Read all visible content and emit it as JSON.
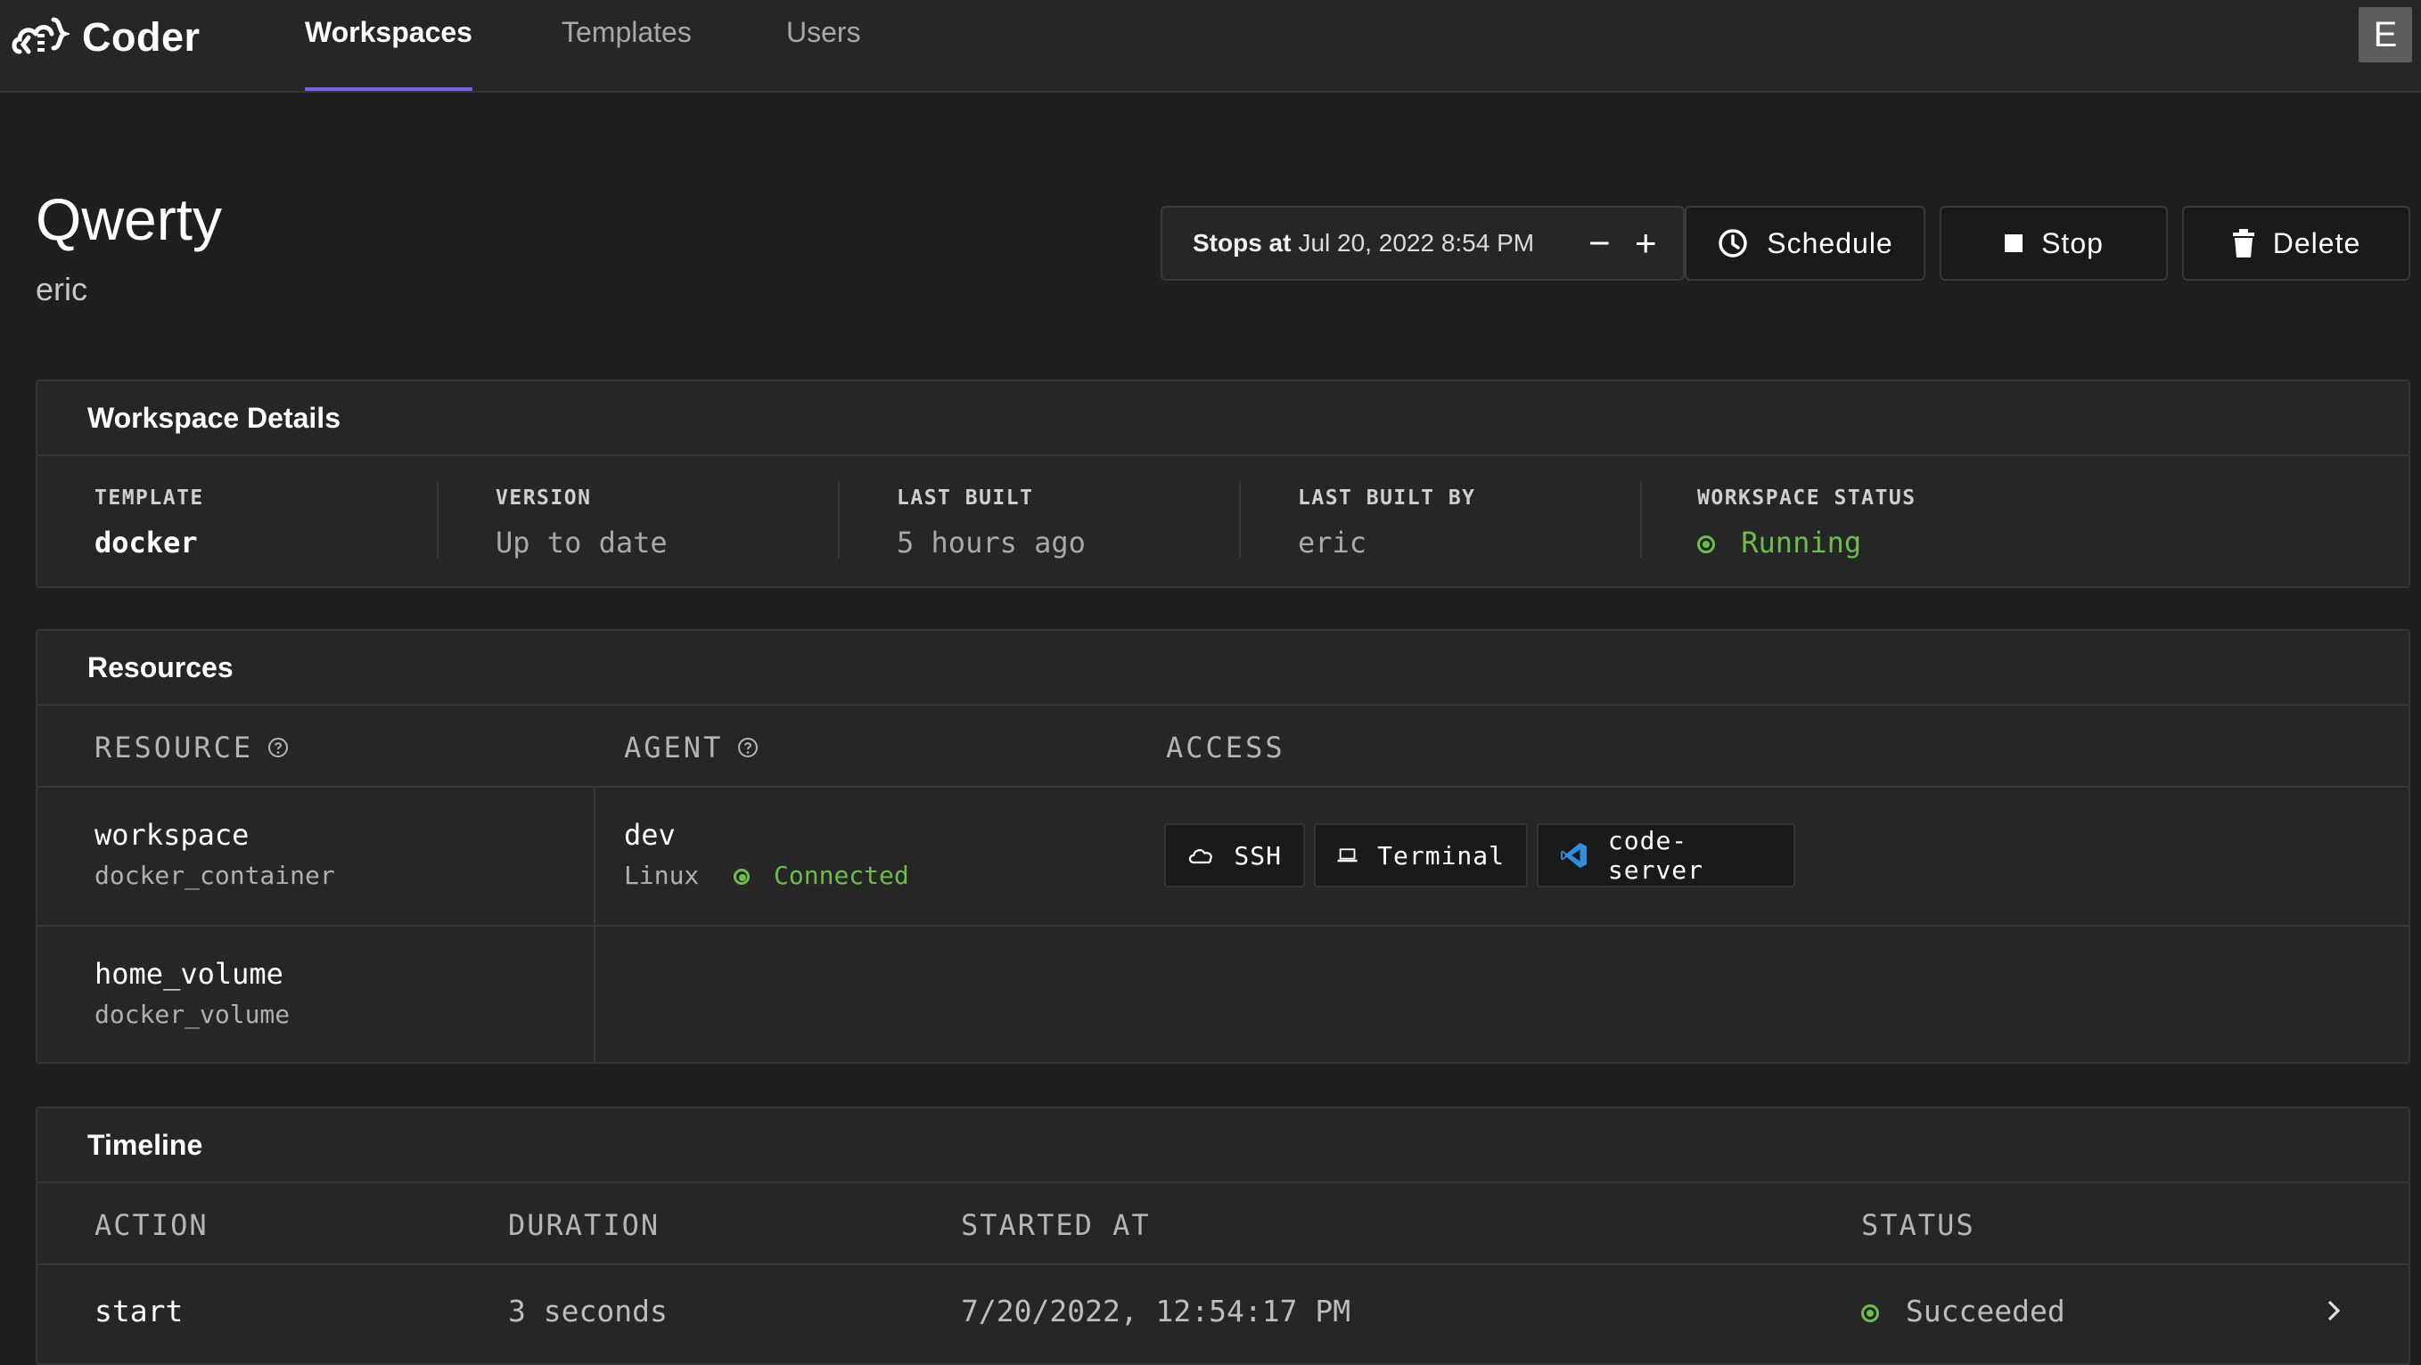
{
  "app": {
    "name": "Coder",
    "avatar_letter": "E"
  },
  "nav": {
    "tabs": [
      {
        "label": "Workspaces",
        "active": true
      },
      {
        "label": "Templates",
        "active": false
      },
      {
        "label": "Users",
        "active": false
      }
    ]
  },
  "workspace": {
    "name": "Qwerty",
    "owner": "eric"
  },
  "schedule": {
    "stops_label": "Stops at",
    "stops_time": "Jul 20, 2022 8:54 PM",
    "decrease_symbol": "−",
    "increase_symbol": "+"
  },
  "actions": {
    "schedule_label": "Schedule",
    "stop_label": "Stop",
    "delete_label": "Delete"
  },
  "details": {
    "title": "Workspace Details",
    "items": [
      {
        "label": "TEMPLATE",
        "value": "docker"
      },
      {
        "label": "VERSION",
        "value": "Up to date"
      },
      {
        "label": "LAST BUILT",
        "value": "5 hours ago"
      },
      {
        "label": "LAST BUILT BY",
        "value": "eric"
      },
      {
        "label": "WORKSPACE STATUS",
        "value": "Running"
      }
    ]
  },
  "resources": {
    "title": "Resources",
    "columns": {
      "resource": "RESOURCE",
      "agent": "AGENT",
      "access": "ACCESS"
    },
    "rows": [
      {
        "name": "workspace",
        "type": "docker_container",
        "agent_name": "dev",
        "agent_os": "Linux",
        "agent_status": "Connected",
        "access": [
          "SSH",
          "Terminal",
          "code-server"
        ]
      },
      {
        "name": "home_volume",
        "type": "docker_volume"
      }
    ]
  },
  "timeline": {
    "title": "Timeline",
    "columns": [
      "ACTION",
      "DURATION",
      "STARTED AT",
      "STATUS"
    ],
    "rows": [
      {
        "action": "start",
        "duration": "3 seconds",
        "started_at": "7/20/2022, 12:54:17 PM",
        "status": "Succeeded"
      }
    ]
  },
  "colors": {
    "accent": "#7b5df0",
    "success": "#6bbd4c",
    "background": "#1f1f1f",
    "panel": "#262626"
  }
}
